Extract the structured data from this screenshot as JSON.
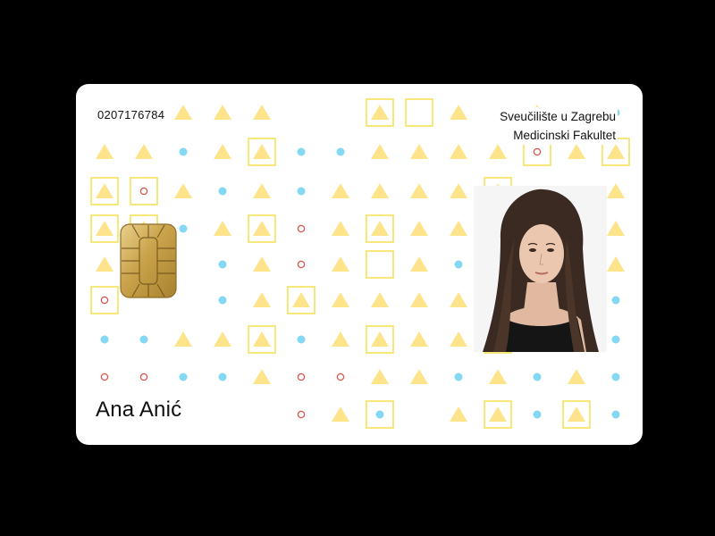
{
  "card": {
    "id_number": "0207176784",
    "institution_line1": "Sveučilište u Zagrebu",
    "institution_line2": "Medicinski Fakultet",
    "holder_name": "Ana Anić"
  },
  "colors": {
    "background": "#000000",
    "card": "#ffffff",
    "triangle": "#fde48b",
    "square_outline": "#f3e35a",
    "dot_blue": "#83d9f3",
    "ring_red": "#e2554a",
    "chip_gold": "#d4b25c"
  },
  "icons": {
    "chip": "smart-card-chip-icon",
    "photo": "portrait-photo"
  }
}
